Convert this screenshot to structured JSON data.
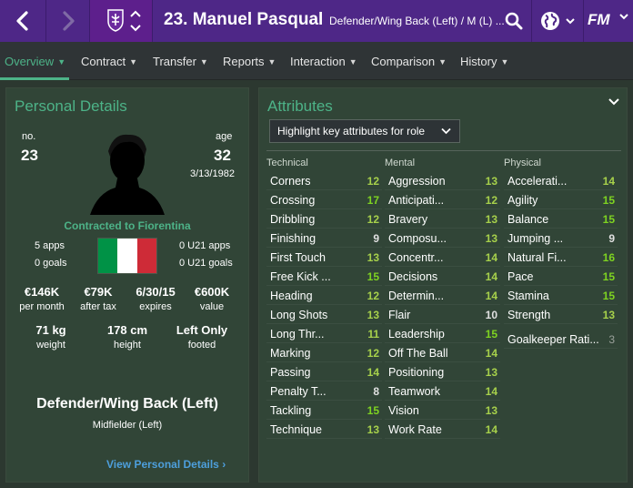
{
  "header": {
    "back_icon": "chevron-left-icon",
    "forward_icon": "chevron-right-icon",
    "club_badge_icon": "fiorentina-badge-icon",
    "player_title": "23. Manuel Pasqual",
    "player_position": "Defender/Wing Back (Left) / M (L) ...",
    "search_icon": "search-icon",
    "globe_icon": "globe-icon",
    "logo": "FM",
    "bar_color": "#4e2787"
  },
  "tabs": [
    {
      "label": "Overview",
      "active": true
    },
    {
      "label": "Contract",
      "active": false
    },
    {
      "label": "Transfer",
      "active": false
    },
    {
      "label": "Reports",
      "active": false
    },
    {
      "label": "Interaction",
      "active": false
    },
    {
      "label": "Comparison",
      "active": false
    },
    {
      "label": "History",
      "active": false
    }
  ],
  "personal": {
    "title": "Personal Details",
    "no_label": "no.",
    "number": "23",
    "age_label": "age",
    "age": "32",
    "dob": "3/13/1982",
    "contract": "Contracted to Fiorentina",
    "apps": "5 apps",
    "goals": "0 goals",
    "u21_apps": "0 U21 apps",
    "u21_goals": "0 U21 goals",
    "flag_colors": [
      "#009246",
      "#ffffff",
      "#ce2b37"
    ],
    "finance": [
      {
        "value": "€146K",
        "label": "per month"
      },
      {
        "value": "€79K",
        "label": "after tax"
      },
      {
        "value": "6/30/15",
        "label": "expires"
      },
      {
        "value": "€600K",
        "label": "value"
      }
    ],
    "physical": [
      {
        "value": "71 kg",
        "label": "weight"
      },
      {
        "value": "178 cm",
        "label": "height"
      },
      {
        "value": "Left Only",
        "label": "footed"
      }
    ],
    "position_main": "Defender/Wing Back (Left)",
    "position_sub": "Midfielder (Left)",
    "view_link": "View Personal Details"
  },
  "attributes": {
    "title": "Attributes",
    "role_select": "Highlight key attributes for role",
    "columns": [
      {
        "heading": "Technical",
        "items": [
          {
            "name": "Corners",
            "value": 12
          },
          {
            "name": "Crossing",
            "value": 17
          },
          {
            "name": "Dribbling",
            "value": 12
          },
          {
            "name": "Finishing",
            "value": 9
          },
          {
            "name": "First Touch",
            "value": 13
          },
          {
            "name": "Free Kick ...",
            "value": 15
          },
          {
            "name": "Heading",
            "value": 12
          },
          {
            "name": "Long Shots",
            "value": 13
          },
          {
            "name": "Long Thr...",
            "value": 11
          },
          {
            "name": "Marking",
            "value": 12
          },
          {
            "name": "Passing",
            "value": 14
          },
          {
            "name": "Penalty T...",
            "value": 8
          },
          {
            "name": "Tackling",
            "value": 15
          },
          {
            "name": "Technique",
            "value": 13
          }
        ]
      },
      {
        "heading": "Mental",
        "items": [
          {
            "name": "Aggression",
            "value": 13
          },
          {
            "name": "Anticipati...",
            "value": 12
          },
          {
            "name": "Bravery",
            "value": 13
          },
          {
            "name": "Composu...",
            "value": 13
          },
          {
            "name": "Concentr...",
            "value": 14
          },
          {
            "name": "Decisions",
            "value": 14
          },
          {
            "name": "Determin...",
            "value": 14
          },
          {
            "name": "Flair",
            "value": 10
          },
          {
            "name": "Leadership",
            "value": 15
          },
          {
            "name": "Off The Ball",
            "value": 14
          },
          {
            "name": "Positioning",
            "value": 13
          },
          {
            "name": "Teamwork",
            "value": 14
          },
          {
            "name": "Vision",
            "value": 13
          },
          {
            "name": "Work Rate",
            "value": 14
          }
        ]
      },
      {
        "heading": "Physical",
        "items": [
          {
            "name": "Accelerati...",
            "value": 14
          },
          {
            "name": "Agility",
            "value": 15
          },
          {
            "name": "Balance",
            "value": 15
          },
          {
            "name": "Jumping ...",
            "value": 9
          },
          {
            "name": "Natural Fi...",
            "value": 16
          },
          {
            "name": "Pace",
            "value": 15
          },
          {
            "name": "Stamina",
            "value": 15
          },
          {
            "name": "Strength",
            "value": 13
          },
          {
            "name": "Goalkeeper Rati...",
            "value": 3
          }
        ]
      }
    ]
  }
}
